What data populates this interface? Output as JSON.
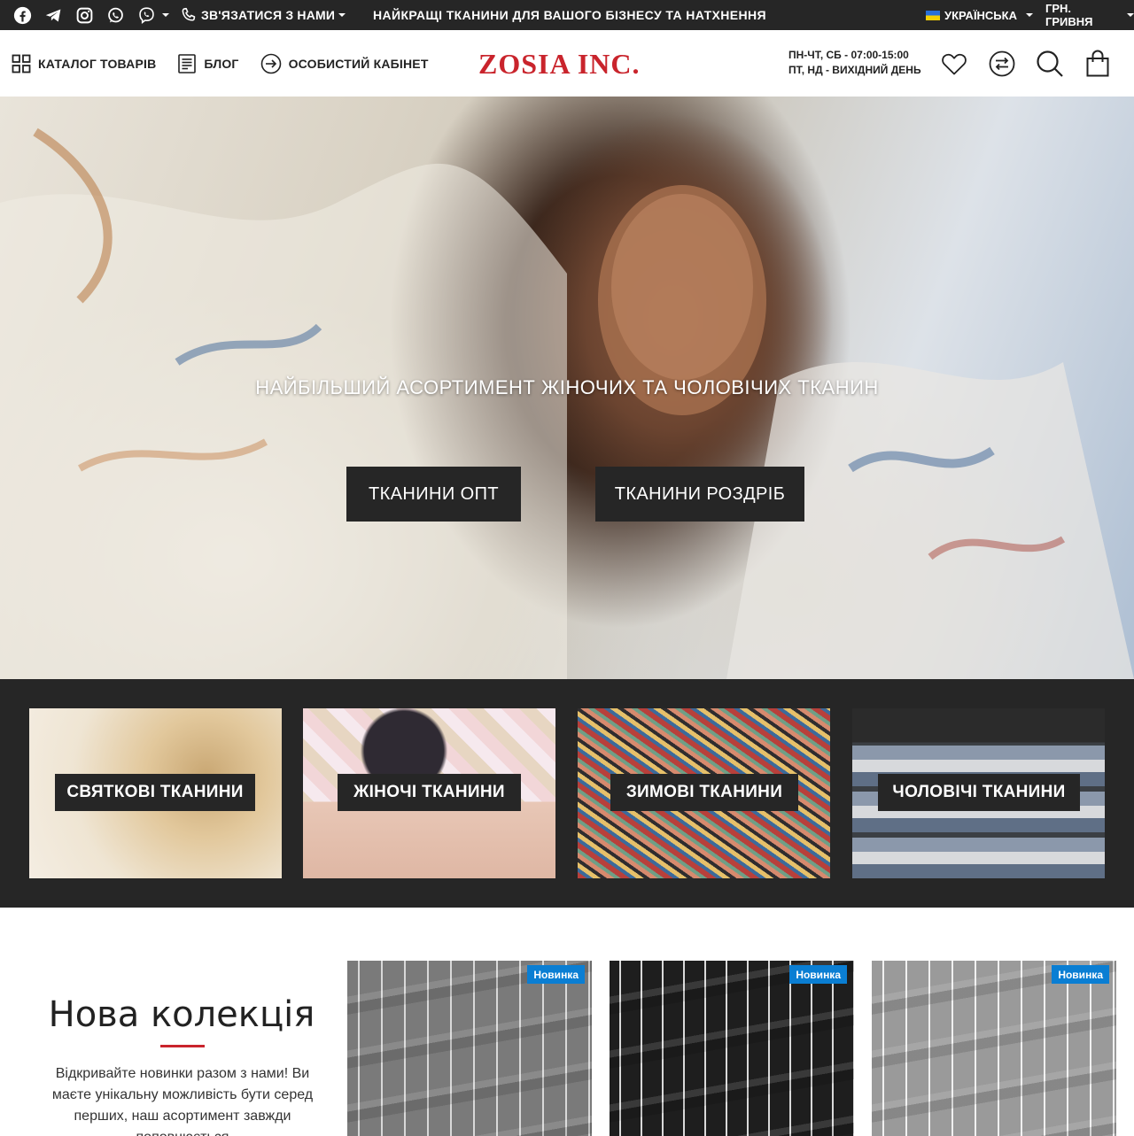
{
  "topbar": {
    "contact_label": "ЗВ'ЯЗАТИСЯ З НАМИ",
    "slogan": "НАЙКРАЩІ ТКАНИНИ ДЛЯ ВАШОГО БІЗНЕСУ ТА НАТХНЕННЯ",
    "language": "УКРАЇНСЬКА",
    "currency": "ГРН. ГРИВНЯ",
    "social_icons": [
      "facebook-icon",
      "telegram-icon",
      "instagram-icon",
      "whatsapp-icon",
      "viber-icon"
    ]
  },
  "header": {
    "nav": {
      "catalog": "КАТАЛОГ ТОВАРІВ",
      "blog": "БЛОГ",
      "account": "ОСОБИСТИЙ КАБІНЕТ"
    },
    "logo": "ZOSIA INC.",
    "hours_line1": "ПН-ЧТ, СБ - 07:00-15:00",
    "hours_line2": "ПТ, НД - ВИХІДНИЙ ДЕНЬ",
    "icons": [
      "heart-icon",
      "compare-icon",
      "search-icon",
      "cart-icon"
    ]
  },
  "hero": {
    "title": "НАЙБІЛЬШИЙ АСОРТИМЕНТ ЖІНОЧИХ ТА ЧОЛОВІЧИХ ТКАНИН",
    "btn_wholesale": "ТКАНИНИ ОПТ",
    "btn_retail": "ТКАНИНИ РОЗДРІБ"
  },
  "categories": [
    {
      "label": "СВЯТКОВІ ТКАНИНИ"
    },
    {
      "label": "ЖІНОЧІ ТКАНИНИ"
    },
    {
      "label": "ЗИМОВІ ТКАНИНИ"
    },
    {
      "label": "ЧОЛОВІЧІ ТКАНИНИ"
    }
  ],
  "collection": {
    "title": "Нова колекція",
    "text": "Відкривайте новинки разом з нами! Ви маєте унікальну можливість бути серед перших, наш асортимент завжди поповнюється",
    "products": [
      {
        "badge": "Новинка"
      },
      {
        "badge": "Новинка"
      },
      {
        "badge": "Новинка"
      }
    ]
  },
  "colors": {
    "dark": "#262626",
    "brand_red": "#c9242c",
    "badge_blue": "#0a7ed3"
  }
}
